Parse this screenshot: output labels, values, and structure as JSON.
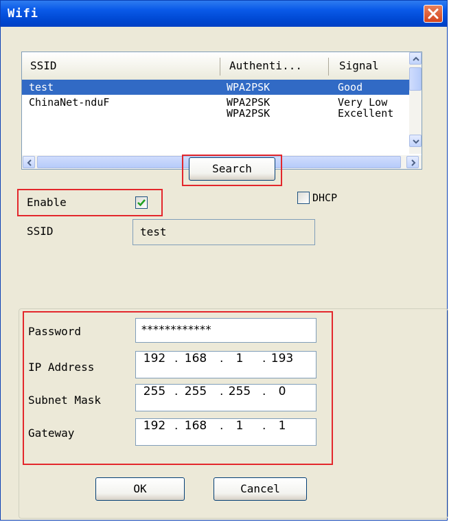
{
  "window": {
    "title": "Wifi"
  },
  "list": {
    "columns": [
      "SSID",
      "Authenti...",
      "Signal"
    ],
    "rows": [
      {
        "ssid": "test",
        "auth": "WPA2PSK",
        "signal": "Good",
        "selected": true
      },
      {
        "ssid": "ChinaNet-nduF",
        "auth": "WPA2PSK",
        "signal": "Very Low",
        "selected": false
      },
      {
        "ssid": "",
        "auth": "WPA2PSK",
        "signal": "Excellent",
        "selected": false
      }
    ]
  },
  "search_label": "Search",
  "enable": {
    "label": "Enable",
    "checked": true
  },
  "dhcp": {
    "label": "DHCP",
    "checked": false
  },
  "ssid": {
    "label": "SSID",
    "value": "test"
  },
  "password": {
    "label": "Password",
    "value": "************"
  },
  "ip_address": {
    "label": "IP Address",
    "parts": [
      "192",
      "168",
      "1",
      "193"
    ]
  },
  "subnet_mask": {
    "label": "Subnet Mask",
    "parts": [
      "255",
      "255",
      "255",
      "0"
    ]
  },
  "gateway": {
    "label": "Gateway",
    "parts": [
      "192",
      "168",
      "1",
      "1"
    ]
  },
  "ok_label": "OK",
  "cancel_label": "Cancel",
  "colors": {
    "selection": "#316ac5",
    "highlight_box": "#e3262b",
    "titlebar": "#0a5ae8"
  }
}
